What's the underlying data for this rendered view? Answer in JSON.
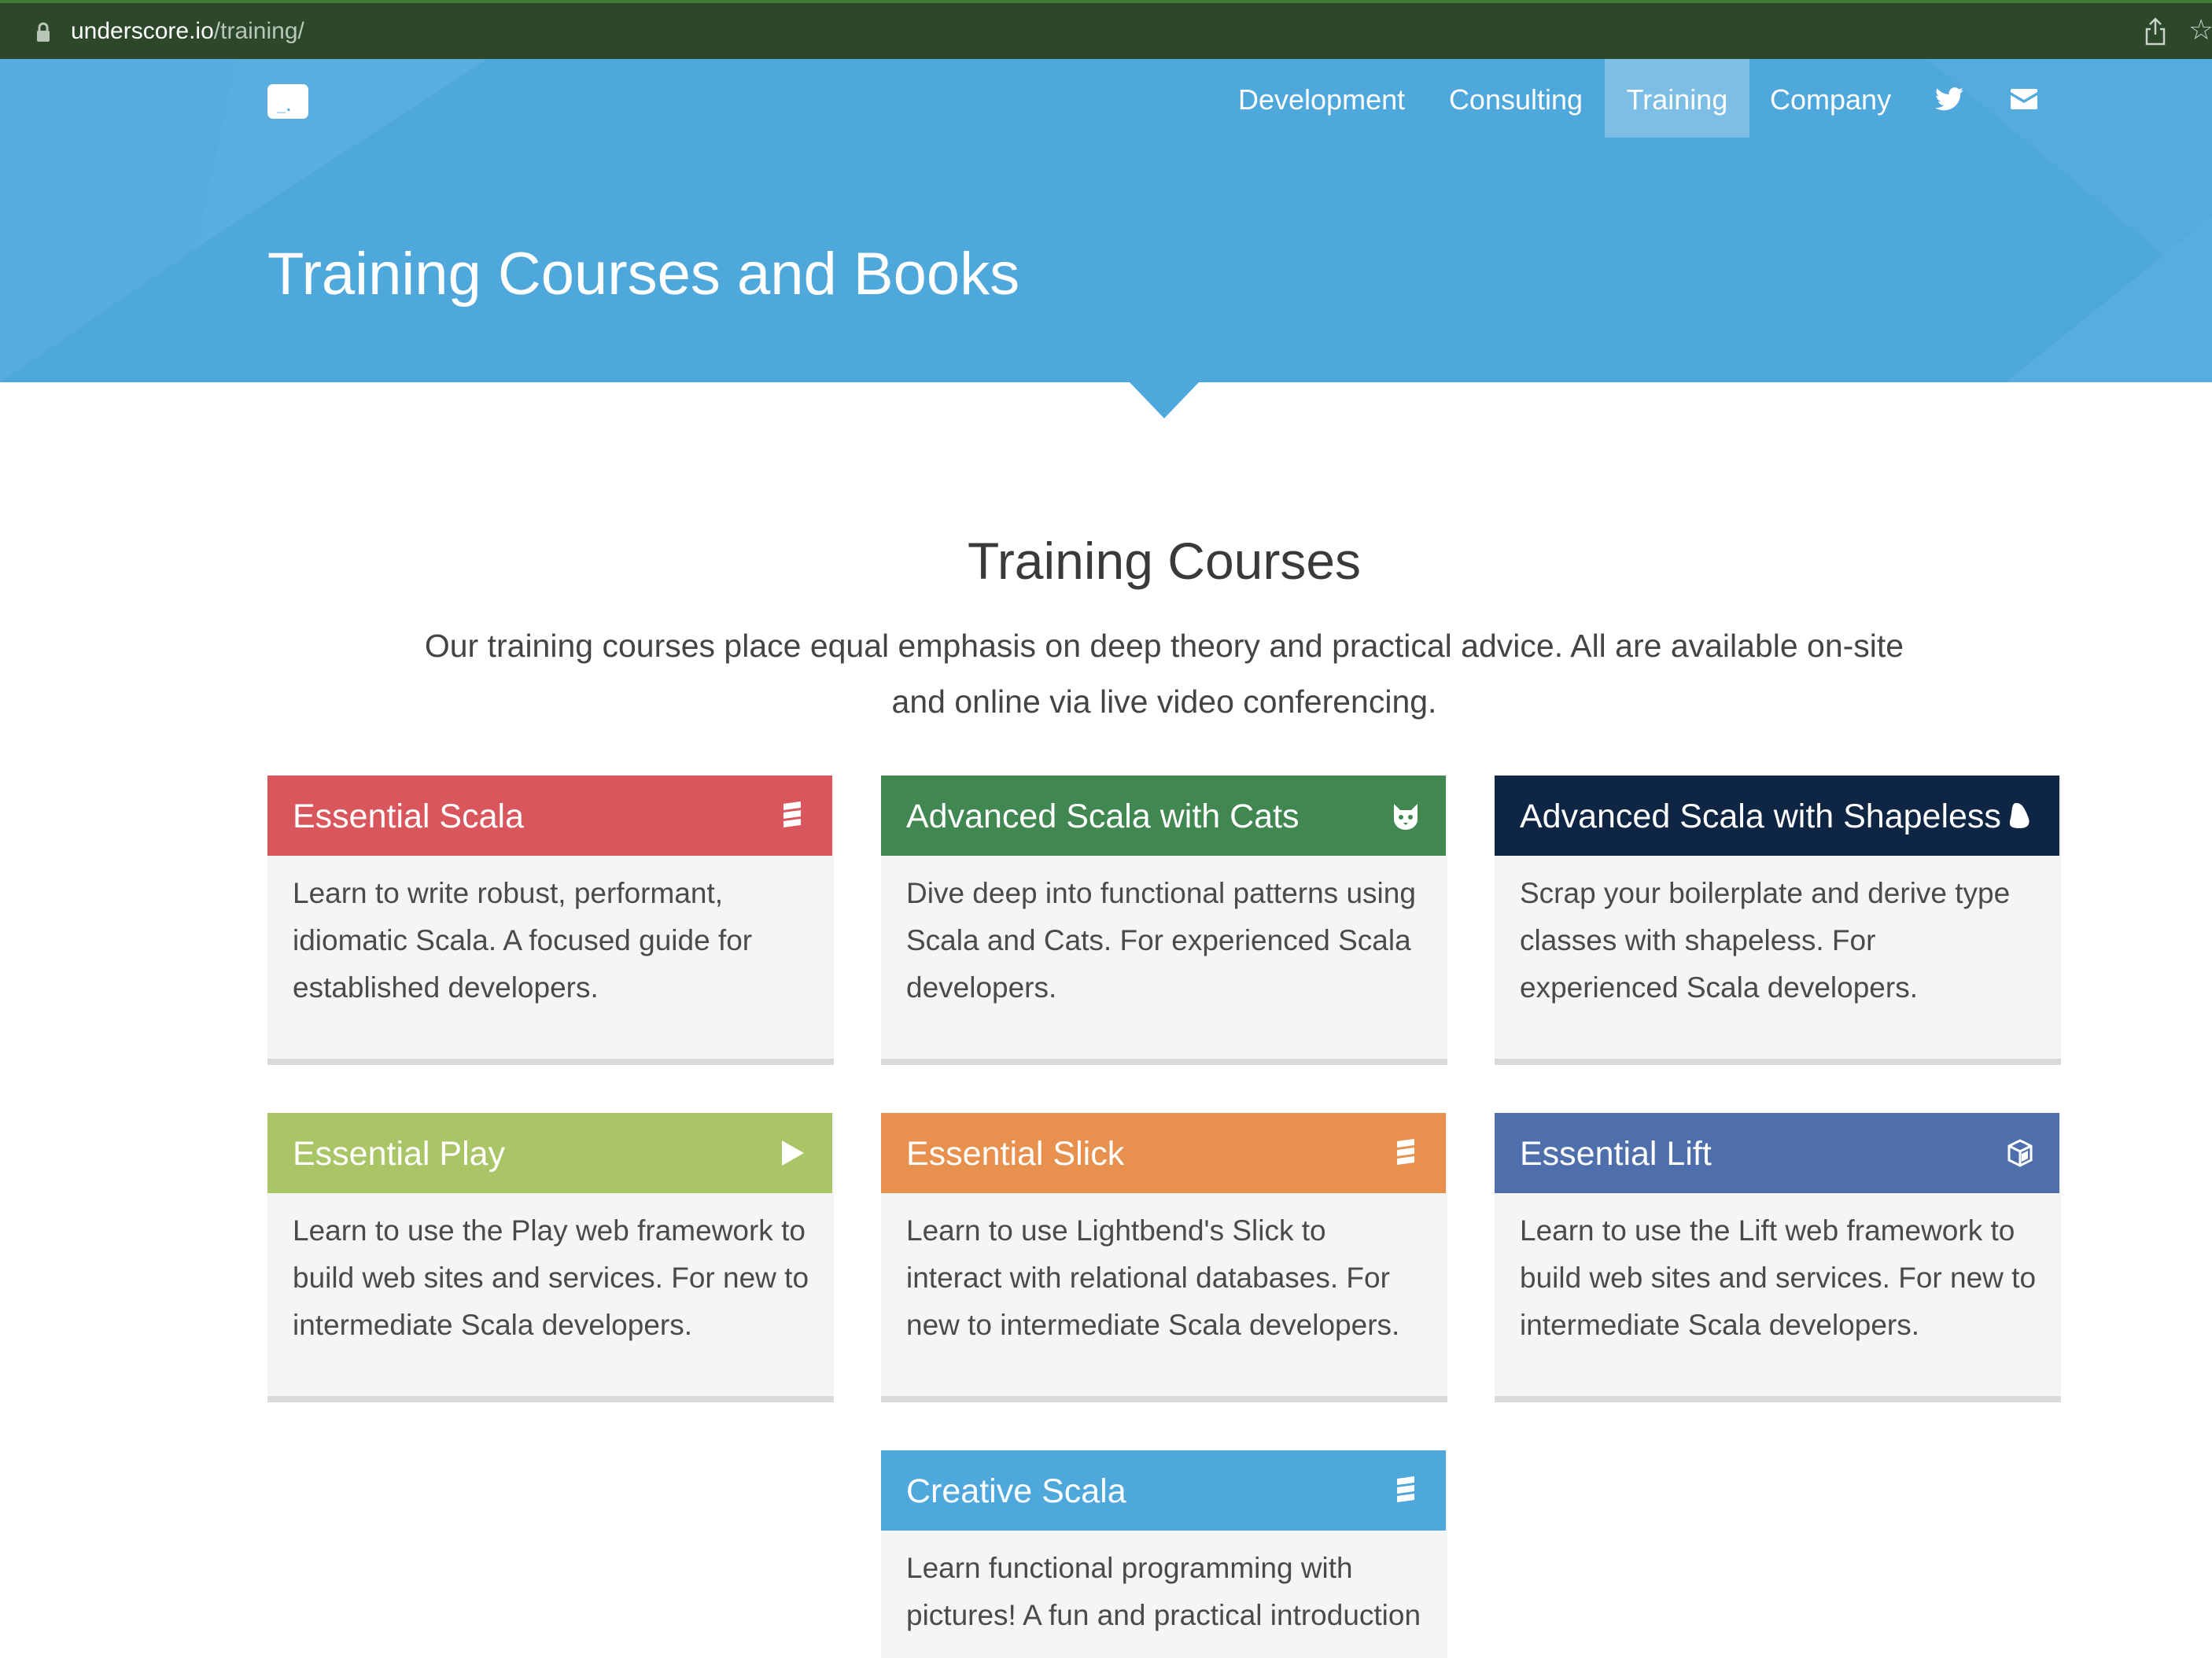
{
  "browser": {
    "url_host": "underscore.io",
    "url_path": "/training/"
  },
  "nav": {
    "items": [
      {
        "label": "Development"
      },
      {
        "label": "Consulting"
      },
      {
        "label": "Training"
      },
      {
        "label": "Company"
      }
    ],
    "active": "Training",
    "icons": [
      "twitter-icon",
      "envelope-icon"
    ]
  },
  "hero": {
    "title": "Training Courses and Books"
  },
  "section": {
    "title": "Training Courses",
    "intro": "Our training courses place equal emphasis on deep theory and practical advice. All are available on-site and online via live video conferencing."
  },
  "courses": [
    {
      "title": "Essential Scala",
      "description": "Learn to write robust, performant, idiomatic Scala. A focused guide for established developers.",
      "color": "#d9575c",
      "icon": "scala-icon"
    },
    {
      "title": "Advanced Scala with Cats",
      "description": "Dive deep into functional patterns using Scala and Cats. For experienced Scala developers.",
      "color": "#408752",
      "icon": "cat-icon"
    },
    {
      "title": "Advanced Scala with Shapeless",
      "description": "Scrap your boilerplate and derive type classes with shapeless. For experienced Scala developers.",
      "color": "#0f2544",
      "icon": "shapeless-icon"
    },
    {
      "title": "Essential Play",
      "description": "Learn to use the Play web framework to build web sites and services. For new to intermediate Scala developers.",
      "color": "#a9c566",
      "icon": "play-icon"
    },
    {
      "title": "Essential Slick",
      "description": "Learn to use Lightbend's Slick to interact with relational databases. For new to intermediate Scala developers.",
      "color": "#e8904e",
      "icon": "scala-icon"
    },
    {
      "title": "Essential Lift",
      "description": "Learn to use the Lift web framework to build web sites and services. For new to intermediate Scala developers.",
      "color": "#4f6fac",
      "icon": "lift-icon"
    },
    {
      "title": "Creative Scala",
      "description": "Learn functional programming with pictures! A fun and practical introduction",
      "color": "#4fa8dc",
      "icon": "scala-icon"
    }
  ]
}
